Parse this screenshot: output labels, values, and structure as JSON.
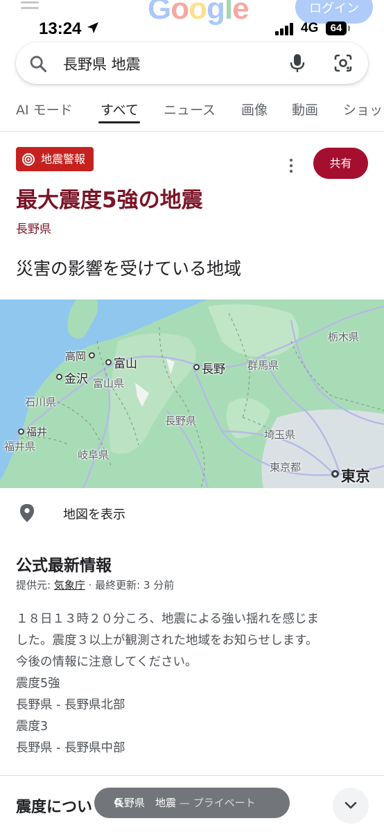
{
  "status_bar": {
    "time": "13:24",
    "network": "4G",
    "battery": "64"
  },
  "header": {
    "logo": "Google",
    "login_label": "ログイン"
  },
  "search": {
    "query": "長野県 地震"
  },
  "tabs": [
    {
      "label": "AI モード"
    },
    {
      "label": "すべて"
    },
    {
      "label": "ニュース"
    },
    {
      "label": "画像"
    },
    {
      "label": "動画"
    },
    {
      "label": "ショッ"
    }
  ],
  "alert": {
    "badge_label": "地震警報",
    "share_label": "共有",
    "title": "最大震度5強の地震",
    "prefecture": "長野県",
    "affected_heading": "災害の影響を受けている地域"
  },
  "map": {
    "labels": {
      "takaoka": "高岡",
      "toyama": "富山",
      "kanazawa": "金沢",
      "toyama_pref": "富山県",
      "ishikawa_pref": "石川県",
      "fukui": "福井",
      "fukui_pref": "福井県",
      "gifu_pref": "岐阜県",
      "nagano": "長野",
      "nagano_pref": "長野県",
      "gunma_pref": "群馬県",
      "tochigi_pref": "栃木県",
      "saitama_pref": "埼玉県",
      "tokyo_pref": "東京都",
      "tokyo": "東京"
    },
    "colors": {
      "land": "#9fd8b0",
      "sea": "#8fc7ef",
      "road": "#b6b9e6"
    }
  },
  "show_map_label": "地図を表示",
  "official": {
    "heading": "公式最新情報",
    "source_prefix": "提供元:",
    "source_link": "気象庁",
    "updated": "· 最終更新: 3 分前",
    "lines": [
      "１８日１３時２０分ころ、地震による強い揺れを感じま",
      "した。震度３以上が観測された地域をお知らせします。",
      "今後の情報に注意してください。",
      "震度5強",
      "長野県 - 長野県北部",
      "震度3",
      "長野県 - 長野県中部"
    ]
  },
  "next_heading": "震度につい",
  "private_pill": {
    "query": "長野県　地震",
    "suffix": "— プライベート"
  },
  "colors": {
    "alert_red": "#c5221f",
    "title_maroon": "#7a1426",
    "share_bg": "#a50e2e"
  }
}
